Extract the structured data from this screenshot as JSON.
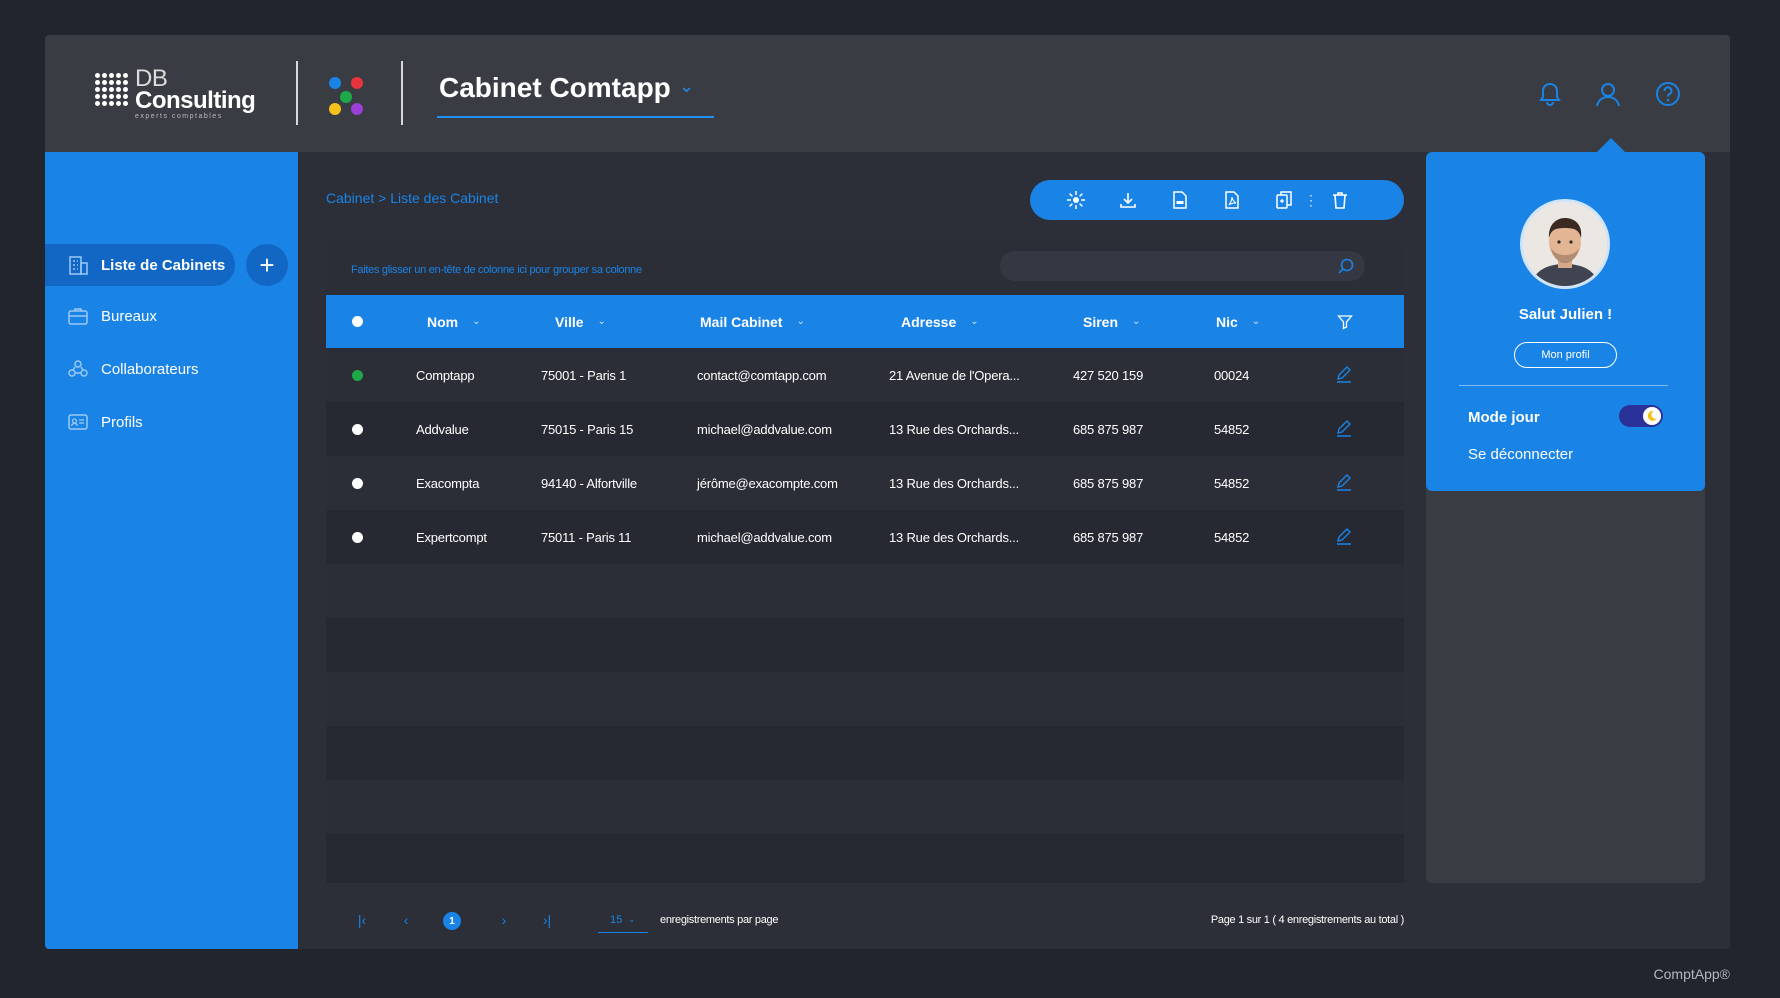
{
  "brand": {
    "logo_title": "DB",
    "logo_title2": "Consulting",
    "logo_subtitle": "experts comptables"
  },
  "header": {
    "cabinet_selected": "Cabinet Comtapp",
    "icons": [
      "bell-icon",
      "user-icon",
      "help-icon"
    ]
  },
  "sidebar": {
    "items": [
      {
        "label": "Liste de Cabinets",
        "icon": "building-icon",
        "active": true
      },
      {
        "label": "Bureaux",
        "icon": "briefcase-icon"
      },
      {
        "label": "Collaborateurs",
        "icon": "people-icon"
      },
      {
        "label": "Profils",
        "icon": "id-card-icon"
      }
    ],
    "add_label": "+"
  },
  "breadcrumb": "Cabinet > Liste des Cabinet",
  "toolbar": {
    "icons": [
      "sun-icon",
      "download-icon",
      "xls-file-icon",
      "pdf-file-icon",
      "copy-icon",
      "trash-icon"
    ]
  },
  "grid": {
    "group_hint": "Faites glisser un en-tête de colonne ici pour grouper sa colonne",
    "search_placeholder": "",
    "columns": [
      "Nom",
      "Ville",
      "Mail Cabinet",
      "Adresse",
      "Siren",
      "Nic"
    ],
    "rows": [
      {
        "status": "green",
        "nom": "Comptapp",
        "ville": "75001 - Paris 1",
        "mail": "contact@comtapp.com",
        "adresse": "21 Avenue de l'Opera...",
        "siren": "427 520 159",
        "nic": "00024"
      },
      {
        "status": "white",
        "nom": "Addvalue",
        "ville": "75015 - Paris 15",
        "mail": "michael@addvalue.com",
        "adresse": "13 Rue des Orchards...",
        "siren": "685 875 987",
        "nic": "54852"
      },
      {
        "status": "white",
        "nom": "Exacompta",
        "ville": "94140 - Alfortville",
        "mail": "jérôme@exacompte.com",
        "adresse": "13 Rue des Orchards...",
        "siren": "685 875 987",
        "nic": "54852"
      },
      {
        "status": "white",
        "nom": "Expertcompt",
        "ville": "75011 - Paris 11",
        "mail": "michael@addvalue.com",
        "adresse": "13 Rue des Orchards...",
        "siren": "685 875 987",
        "nic": "54852"
      }
    ]
  },
  "pager": {
    "current_page": "1",
    "per_page": "15",
    "per_page_label": "enregistrements par page",
    "info": "Page 1 sur 1 ( 4 enregistrements au total )"
  },
  "profile_menu": {
    "greeting": "Salut Julien !",
    "profile_button": "Mon profil",
    "mode_label": "Mode jour",
    "logout": "Se déconnecter"
  },
  "colors": {
    "accent": "#1a83e6",
    "status_active": "#1ea84a",
    "status_inactive": "#ffffff"
  },
  "footer": "ComptApp®"
}
